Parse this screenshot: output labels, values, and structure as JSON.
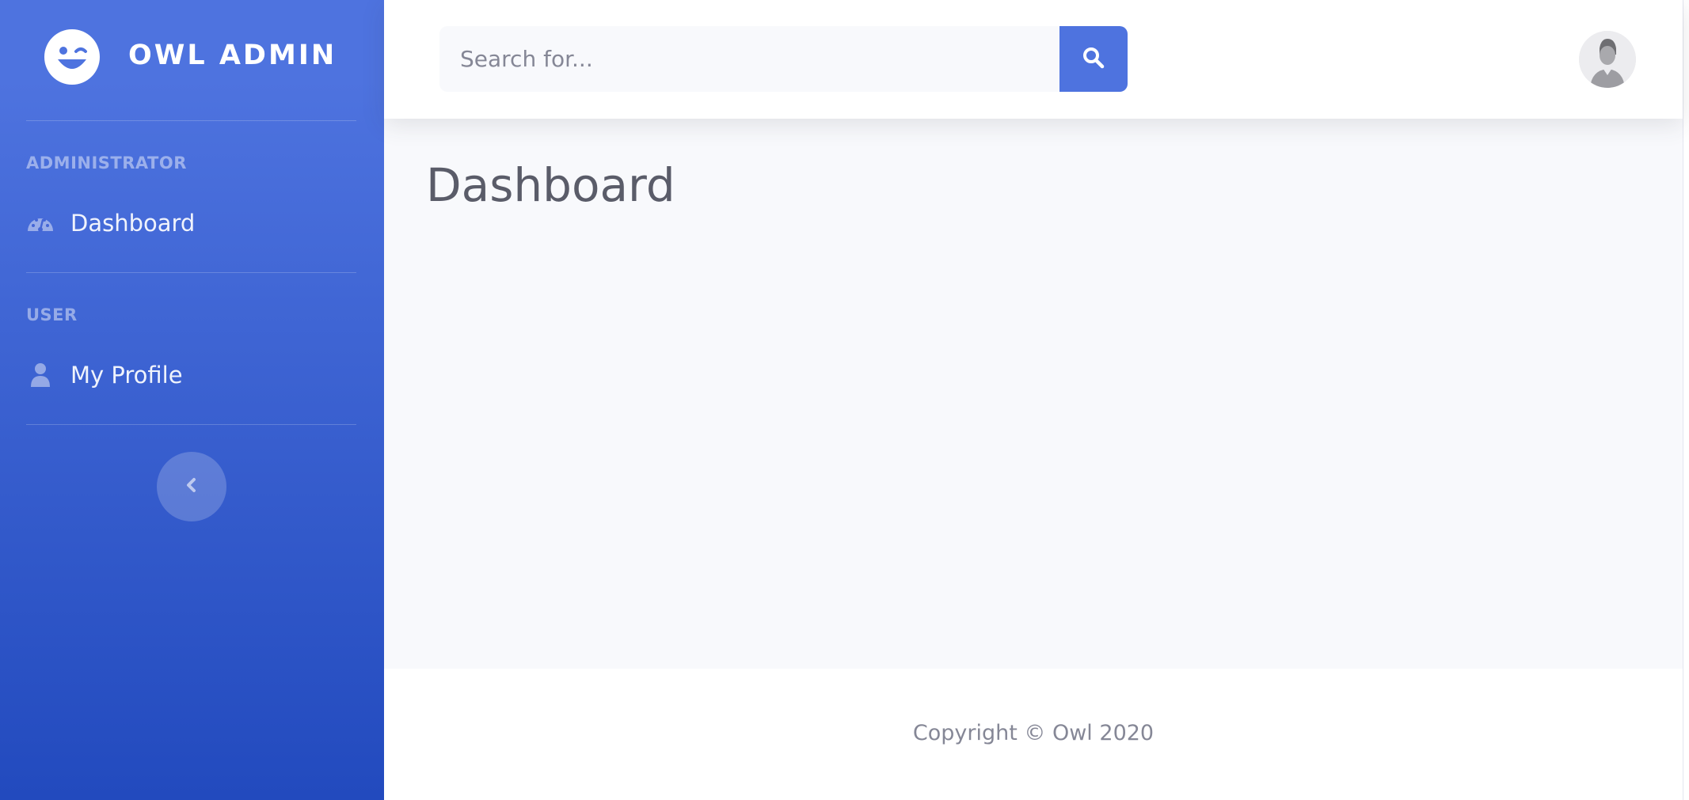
{
  "brand": {
    "name": "OWL ADMIN",
    "logo_icon": "laugh-wink-icon"
  },
  "sidebar": {
    "sections": [
      {
        "heading": "ADMINISTRATOR",
        "items": [
          {
            "label": "Dashboard",
            "icon": "tachometer-icon"
          }
        ]
      },
      {
        "heading": "USER",
        "items": [
          {
            "label": "My Profile",
            "icon": "user-icon"
          }
        ]
      }
    ],
    "toggle_icon": "chevron-left-icon"
  },
  "topbar": {
    "search": {
      "placeholder": "Search for...",
      "value": "",
      "button_icon": "search-icon"
    },
    "avatar_icon": "user-avatar"
  },
  "main": {
    "title": "Dashboard"
  },
  "footer": {
    "copyright": "Copyright © Owl 2020"
  },
  "colors": {
    "primary": "#4e73df",
    "primary_dark": "#224abe",
    "content_bg": "#f8f9fc",
    "text_gray": "#5a5c69",
    "muted": "#858796"
  }
}
